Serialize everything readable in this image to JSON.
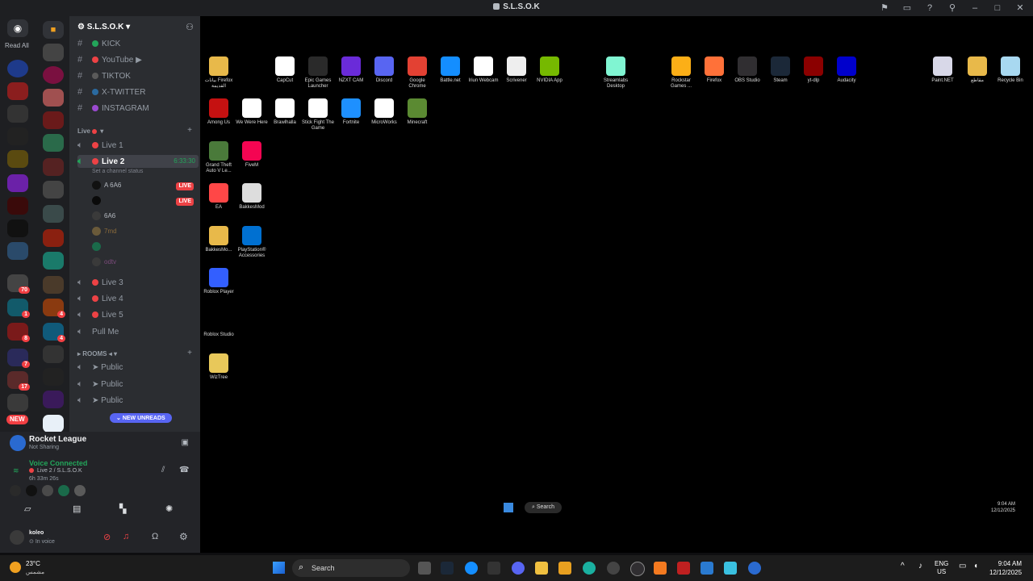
{
  "window": {
    "title": "S.L.S.O.K"
  },
  "rail": {
    "read_all": "Read All",
    "new_badge": "NEW",
    "badges": [
      "70",
      "1",
      "8",
      "7",
      "17",
      "4",
      "4",
      "9"
    ]
  },
  "channels": {
    "server_name": "S.L.S.O.K",
    "text_channels": [
      "KICK",
      "YouTube",
      "TIKTOK",
      "X-TWITTER",
      "INSTAGRAM"
    ],
    "live_category": "Live",
    "voice_channels": [
      "Live 1",
      "Live 2",
      "Live 3",
      "Live 4",
      "Live 5",
      "Pull Me"
    ],
    "live2_timer": "6:33:30",
    "live2_status": "Set a channel status",
    "users": [
      {
        "name": "A 6A6",
        "live": "LIVE"
      },
      {
        "name": "",
        "live": "LIVE"
      },
      {
        "name": "6A6",
        "live": ""
      },
      {
        "name": "7md",
        "live": ""
      },
      {
        "name": "",
        "live": ""
      },
      {
        "name": "odtv",
        "live": ""
      }
    ],
    "rooms_category": "ROOMS",
    "rooms": [
      "Public",
      "Public",
      "Public"
    ],
    "new_unreads": "NEW UNREADS"
  },
  "panel": {
    "activity_title": "Rocket League",
    "activity_status": "Not Sharing",
    "voice_status": "Voice Connected",
    "voice_channel": "Live 2 / S.L.S.O.K",
    "voice_time": "6h 33m 26s",
    "username": "koleo",
    "user_status": "In voice"
  },
  "desktop_icons": [
    {
      "label": "بيانات Firefox القديمة",
      "color": "#e8b94a"
    },
    {
      "label": "CapCut",
      "color": "#ffffff"
    },
    {
      "label": "Epic Games Launcher",
      "color": "#2a2a2a"
    },
    {
      "label": "NZXT CAM",
      "color": "#6a2bd9"
    },
    {
      "label": "Discord",
      "color": "#5865f2"
    },
    {
      "label": "Google Chrome",
      "color": "#e34133"
    },
    {
      "label": "Battle.net",
      "color": "#148eff"
    },
    {
      "label": "Iriun Webcam",
      "color": "#ffffff"
    },
    {
      "label": "Scrivener",
      "color": "#eeeeee"
    },
    {
      "label": "NVIDIA App",
      "color": "#76b900"
    },
    {
      "label": "Streamlabs Desktop",
      "color": "#80f5d2"
    },
    {
      "label": "Rockstar Games ...",
      "color": "#fcaf17"
    },
    {
      "label": "Firefox",
      "color": "#ff7139"
    },
    {
      "label": "OBS Studio",
      "color": "#302e31"
    },
    {
      "label": "Steam",
      "color": "#1b2838"
    },
    {
      "label": "yt-dlp",
      "color": "#8b0000"
    },
    {
      "label": "Audacity",
      "color": "#0000cc"
    },
    {
      "label": "Paint.NET",
      "color": "#d8d8e8"
    },
    {
      "label": "مقاطع",
      "color": "#e8b94a"
    },
    {
      "label": "Recycle Bin",
      "color": "#a8d8f0"
    },
    {
      "label": "Among Us",
      "color": "#c51111"
    },
    {
      "label": "We Were Here",
      "color": "#ffffff"
    },
    {
      "label": "Brawlhalla",
      "color": "#ffffff"
    },
    {
      "label": "Stick Fight The Game",
      "color": "#ffffff"
    },
    {
      "label": "Fortnite",
      "color": "#1e90ff"
    },
    {
      "label": "MicroWorks",
      "color": "#ffffff"
    },
    {
      "label": "Minecraft",
      "color": "#5b8a32"
    },
    {
      "label": "Grand Theft Auto V Le...",
      "color": "#4a7a3a"
    },
    {
      "label": "FiveM",
      "color": "#f40552"
    },
    {
      "label": "EA",
      "color": "#ff4747"
    },
    {
      "label": "BakkesMod",
      "color": "#dddddd"
    },
    {
      "label": "BakkesMo...",
      "color": "#e8b94a"
    },
    {
      "label": "PlayStation® Accessories",
      "color": "#0070d1"
    },
    {
      "label": "Roblox Player",
      "color": "#335fff"
    },
    {
      "label": "Roblox Studio",
      "color": "#000000"
    },
    {
      "label": "WizTree",
      "color": "#e8c85a"
    }
  ],
  "inner_taskbar": {
    "search": "Search",
    "time": "9:04 AM",
    "date": "12/12/2025"
  },
  "taskbar": {
    "weather_temp": "23°C",
    "weather_desc": "مشمس",
    "search": "Search",
    "lang": "ENG",
    "region": "US",
    "time": "9:04 AM",
    "date": "12/12/2025",
    "colors": {
      "accent": "#5865f2",
      "live": "#ed4245",
      "voice": "#23a55a"
    }
  }
}
